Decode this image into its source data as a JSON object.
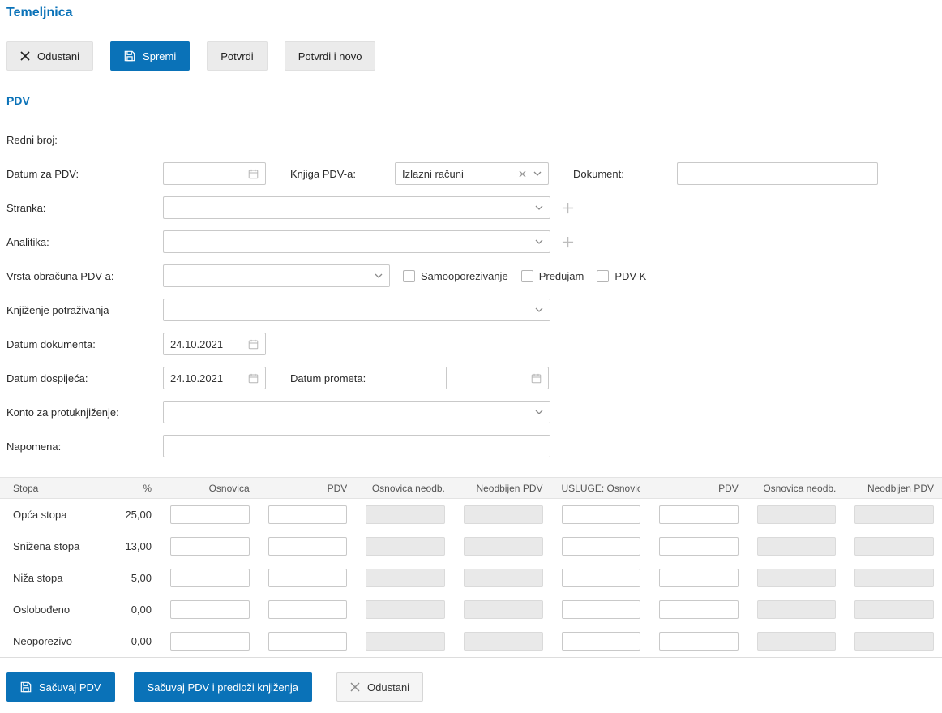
{
  "page": {
    "title": "Temeljnica"
  },
  "colors": {
    "accent": "#0a72b8",
    "button_gray": "#ebebeb",
    "disabled_input": "#e9e9e9",
    "table_header_bg": "#f4f4f4"
  },
  "toolbar": {
    "cancel_label": "Odustani",
    "save_label": "Spremi",
    "confirm_label": "Potvrdi",
    "confirm_new_label": "Potvrdi i novo"
  },
  "form": {
    "section_title": "PDV",
    "labels": {
      "redni_broj": "Redni broj:",
      "datum_za_pdv": "Datum za PDV:",
      "knjiga_pdv": "Knjiga PDV-a:",
      "dokument": "Dokument:",
      "stranka": "Stranka:",
      "analitika": "Analitika:",
      "vrsta_obracuna": "Vrsta obračuna PDV-a:",
      "knjizenje_potrazivanja": "Knjiženje potraživanja",
      "datum_dokumenta": "Datum dokumenta:",
      "datum_dospijeca": "Datum dospijeća:",
      "datum_prometa": "Datum prometa:",
      "konto_za_protuknjizenje": "Konto za protuknjiženje:",
      "napomena": "Napomena:"
    },
    "values": {
      "datum_za_pdv": "",
      "knjiga_pdv_selected": "Izlazni računi",
      "dokument": "",
      "datum_dokumenta": "24.10.2021",
      "datum_dospijeca": "24.10.2021",
      "datum_prometa": "",
      "napomena": ""
    },
    "checkboxes": [
      {
        "label": "Samooporezivanje",
        "checked": false
      },
      {
        "label": "Predujam",
        "checked": false
      },
      {
        "label": "PDV-K",
        "checked": false
      }
    ]
  },
  "table": {
    "headers": [
      "Stopa",
      "%",
      "Osnovica",
      "PDV",
      "Osnovica neodb.",
      "Neodbijen PDV",
      "USLUGE: Osnovica",
      "PDV",
      "Osnovica neodb.",
      "Neodbijen PDV"
    ],
    "rows": [
      {
        "label": "Opća stopa",
        "rate": "25,00"
      },
      {
        "label": "Snižena stopa",
        "rate": "13,00"
      },
      {
        "label": "Niža stopa",
        "rate": "5,00"
      },
      {
        "label": "Oslobođeno",
        "rate": "0,00"
      },
      {
        "label": "Neoporezivo",
        "rate": "0,00"
      }
    ]
  },
  "footer": {
    "save_pdv_label": "Sačuvaj PDV",
    "save_pdv_suggest_label": "Sačuvaj PDV i predloži knjiženja",
    "cancel_label": "Odustani"
  }
}
